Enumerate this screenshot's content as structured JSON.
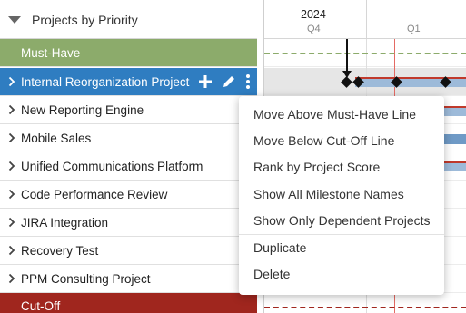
{
  "header": {
    "title": "Projects by Priority"
  },
  "rows": [
    {
      "label": "Must-Have"
    },
    {
      "label": "Internal Reorganization Project"
    },
    {
      "label": "New Reporting Engine"
    },
    {
      "label": "Mobile Sales"
    },
    {
      "label": "Unified Communications Platform"
    },
    {
      "label": "Code Performance Review"
    },
    {
      "label": "JIRA Integration"
    },
    {
      "label": "Recovery Test"
    },
    {
      "label": "PPM Consulting Project"
    },
    {
      "label": "Cut-Off"
    }
  ],
  "timeline": {
    "year": "2024",
    "quarter_a": "Q4",
    "quarter_b": "Q1"
  },
  "context_menu": {
    "items": [
      "Move Above Must-Have Line",
      "Move Below Cut-Off Line",
      "Rank by Project Score",
      "Show All Milestone Names",
      "Show Only Dependent Projects",
      "Duplicate",
      "Delete"
    ]
  },
  "colors": {
    "must_have_band": "#8cab6b",
    "cut_off_band": "#a0261e",
    "selected_row": "#2f7dc1",
    "bar": "#9dbad9"
  },
  "icons": {
    "collapse": "triangle-down-icon",
    "expand": "chevron-right-icon",
    "add": "plus-icon",
    "edit": "pencil-icon",
    "more": "kebab-icon"
  }
}
